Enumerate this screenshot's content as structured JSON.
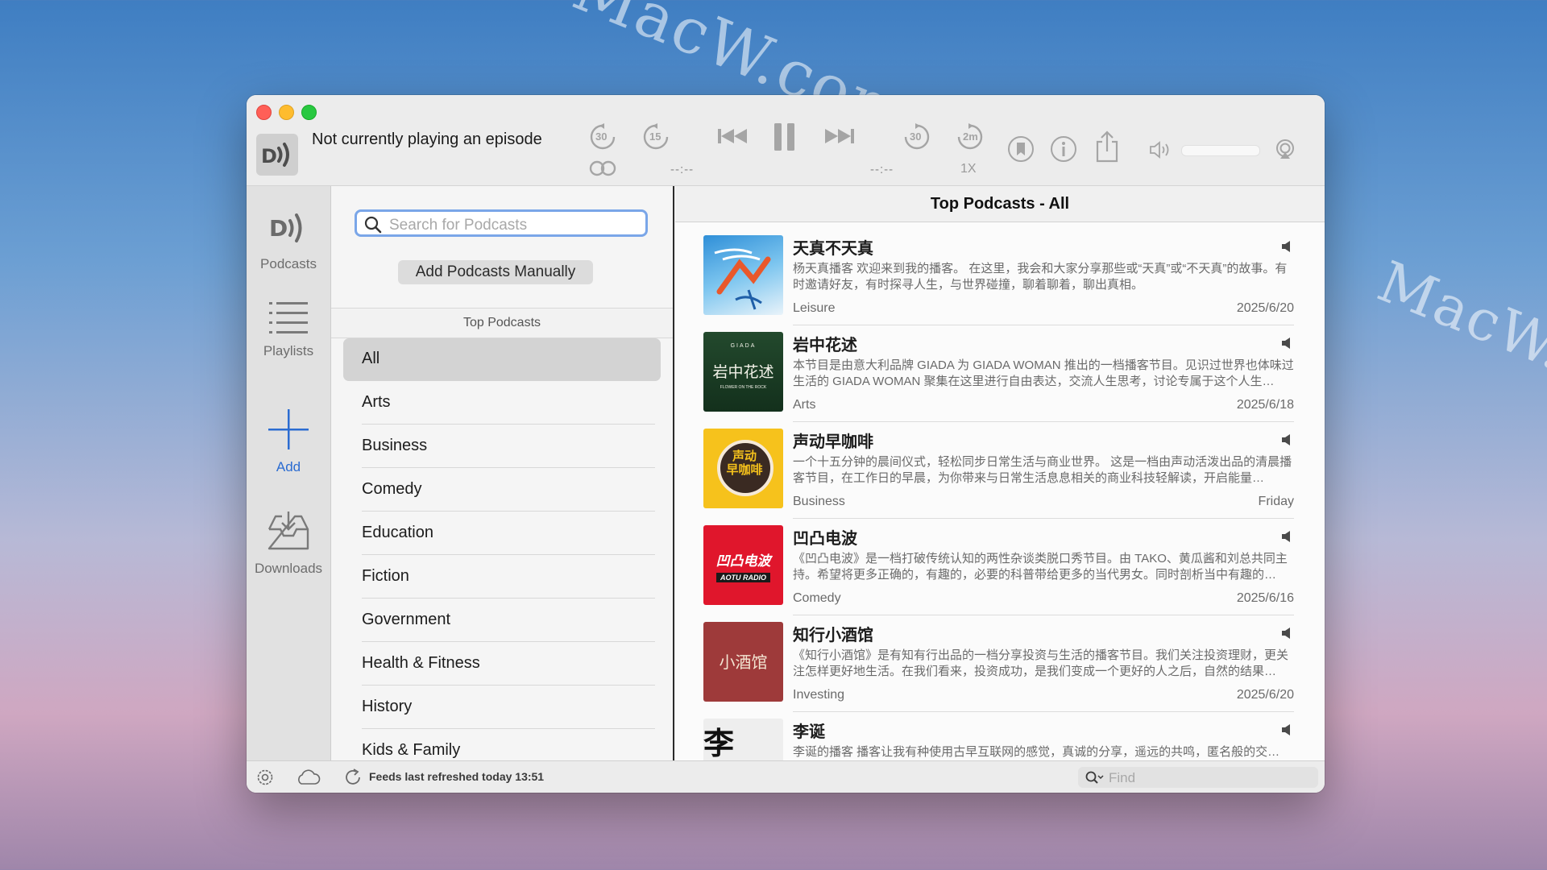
{
  "player": {
    "status": "Not currently playing an episode",
    "elapsed": "--:--",
    "remaining": "--:--",
    "speed": "1X",
    "skip_back_long": "30",
    "skip_back_short": "15",
    "skip_fwd_long": "30",
    "skip_fwd_short": "2m"
  },
  "nav": {
    "podcasts": "Podcasts",
    "playlists": "Playlists",
    "add": "Add",
    "downloads": "Downloads"
  },
  "search": {
    "placeholder": "Search for Podcasts"
  },
  "add_manual": "Add Podcasts Manually",
  "categories_header": "Top Podcasts",
  "categories": [
    "All",
    "Arts",
    "Business",
    "Comedy",
    "Education",
    "Fiction",
    "Government",
    "Health & Fitness",
    "History",
    "Kids & Family"
  ],
  "list_header": "Top Podcasts - All",
  "podcasts": [
    {
      "title": "天真不天真",
      "desc": "杨天真播客 欢迎来到我的播客。 在这里，我会和大家分享那些或“天真”或“不天真”的故事。有时邀请好友，有时探寻人生，与世界碰撞，聊着聊着，聊出真相。",
      "genre": "Leisure",
      "date": "2025/6/20"
    },
    {
      "title": "岩中花述",
      "desc": "本节目是由意大利品牌 GIADA 为 GIADA WOMAN 推出的一档播客节目。见识过世界也体味过生活的 GIADA WOMAN 聚集在这里进行自由表达，交流人生思考，讨论专属于这个人生…",
      "genre": "Arts",
      "date": "2025/6/18"
    },
    {
      "title": "声动早咖啡",
      "desc": "一个十五分钟的晨间仪式，轻松同步日常生活与商业世界。 这是一档由声动活泼出品的清晨播客节目，在工作日的早晨，为你带来与日常生活息息相关的商业科技轻解读，开启能量…",
      "genre": "Business",
      "date": "Friday"
    },
    {
      "title": "凹凸电波",
      "desc": "《凹凸电波》是一档打破传统认知的两性杂谈类脱口秀节目。由 TAKO、黄瓜酱和刘总共同主持。希望将更多正确的，有趣的，必要的科普带给更多的当代男女。同时剖析当中有趣的…",
      "genre": "Comedy",
      "date": "2025/6/16"
    },
    {
      "title": "知行小酒馆",
      "desc": "《知行小酒馆》是有知有行出品的一档分享投资与生活的播客节目。我们关注投资理财，更关注怎样更好地生活。在我们看来，投资成功，是我们变成一个更好的人之后，自然的结果…",
      "genre": "Investing",
      "date": "2025/6/20"
    },
    {
      "title": "李诞",
      "desc": "李诞的播客 播客让我有种使用古早互联网的感觉，真诚的分享，遥远的共鸣，匿名般的交…",
      "genre": "",
      "date": ""
    }
  ],
  "artwork": {
    "p2_top": "GIADA",
    "p2_main": "岩中花述",
    "p2_sub": "FLOWER ON THE ROCK",
    "p3_main": "声动\n早咖啡",
    "p4_main": "凹凸电波",
    "p4_sub": "AOTU RADIO",
    "p5_main": "小酒馆",
    "p6_main": "李"
  },
  "status_bar": {
    "refresh": "Feeds last refreshed today 13:51"
  },
  "find": {
    "placeholder": "Find"
  },
  "watermark": "MacW.com",
  "colors": {
    "accent": "#2b6cd1",
    "search_focus": "#7aa6e8"
  }
}
